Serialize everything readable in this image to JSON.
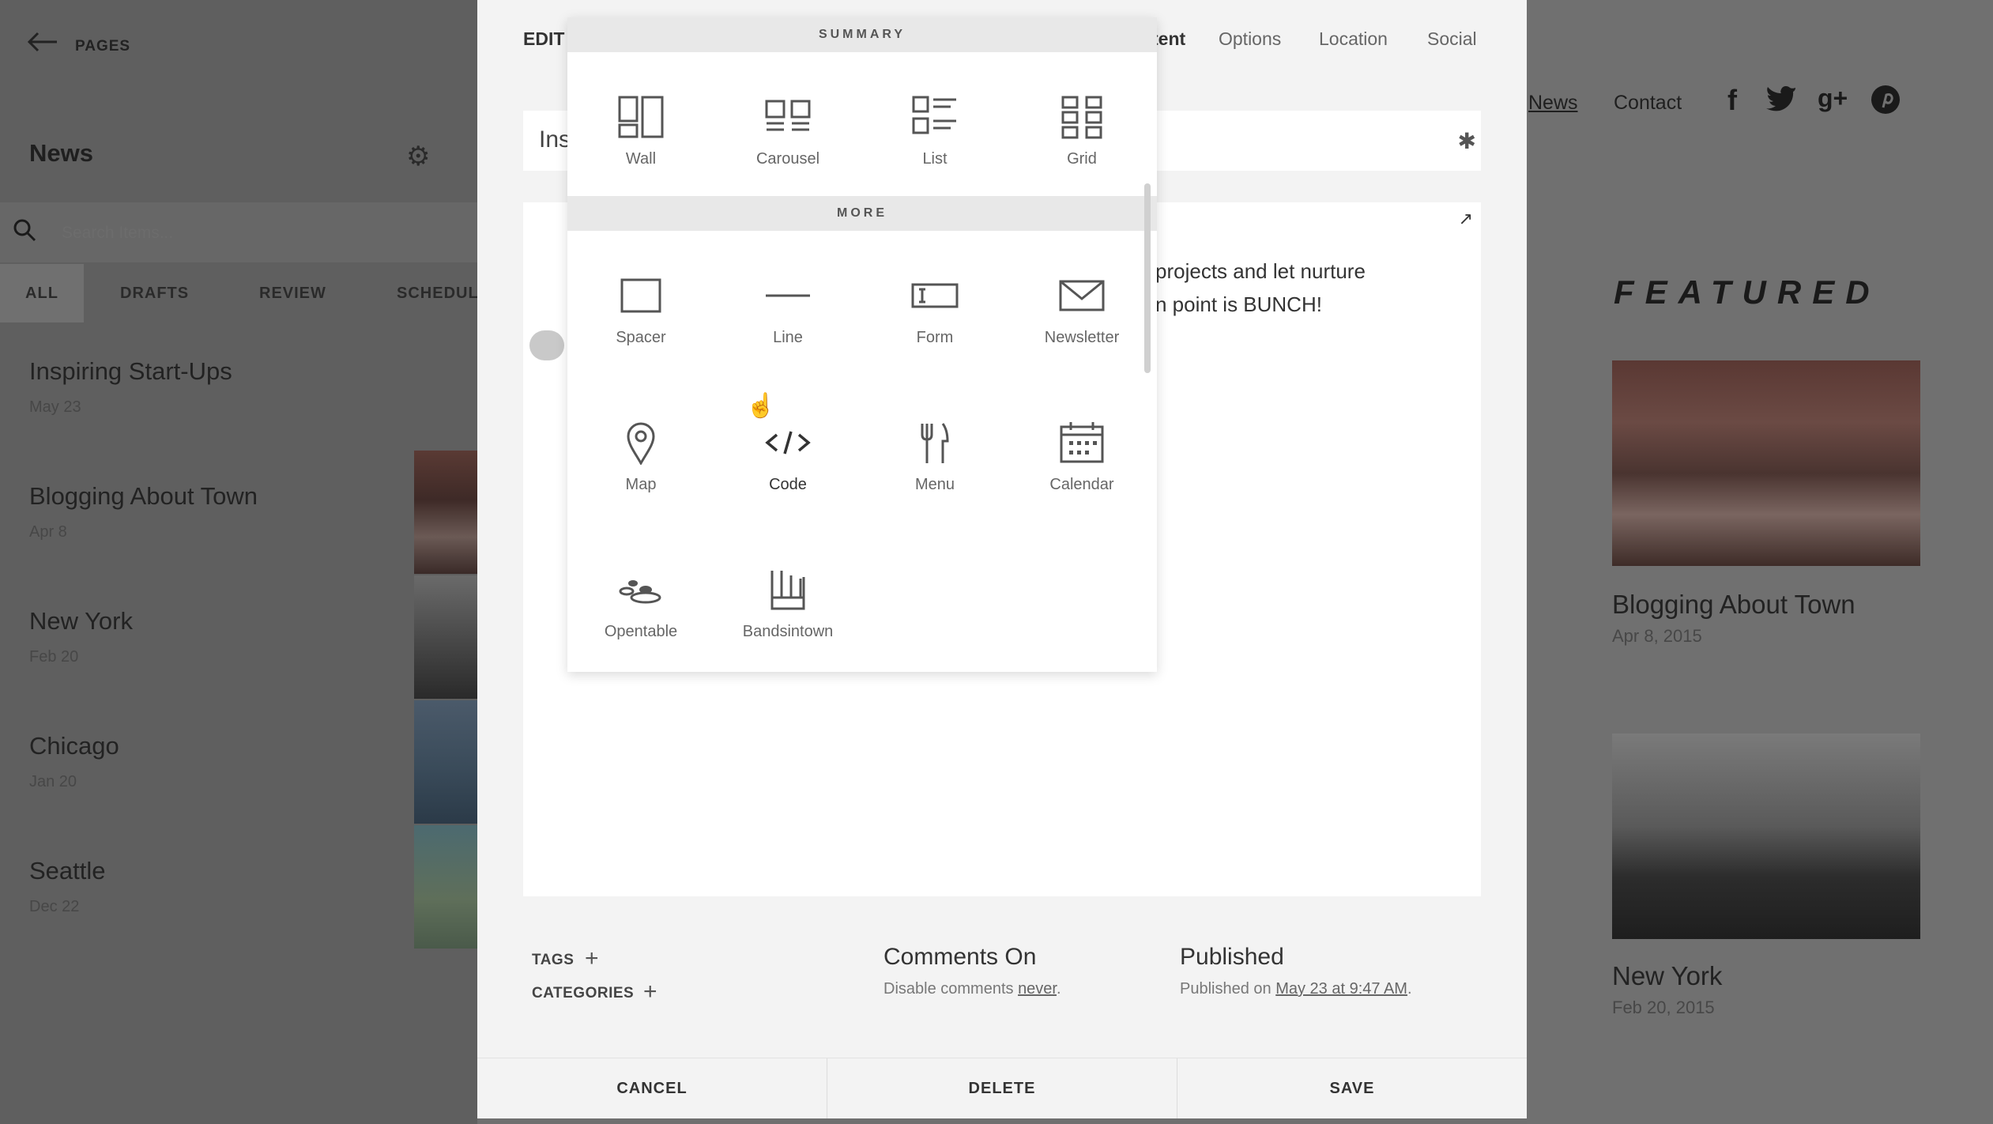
{
  "sidebar": {
    "back_label": "PAGES",
    "title": "News",
    "search_placeholder": "Search Items...",
    "tabs": [
      "ALL",
      "DRAFTS",
      "REVIEW",
      "SCHEDUL"
    ],
    "active_tab": "ALL",
    "items": [
      {
        "title": "Inspiring Start-Ups",
        "date": "May 23"
      },
      {
        "title": "Blogging About Town",
        "date": "Apr 8"
      },
      {
        "title": "New York",
        "date": "Feb 20"
      },
      {
        "title": "Chicago",
        "date": "Jan 20"
      },
      {
        "title": "Seattle",
        "date": "Dec 22"
      }
    ]
  },
  "preview": {
    "nav": [
      "News",
      "Contact"
    ],
    "social_icons": [
      "facebook-icon",
      "twitter-icon",
      "google-plus-icon",
      "pinterest-icon"
    ],
    "featured_heading": "FEATURED",
    "featured": [
      {
        "title": "Blogging About Town",
        "date": "Apr 8, 2015"
      },
      {
        "title": "New York",
        "date": "Feb 20, 2015"
      }
    ]
  },
  "editor": {
    "header_left": "EDIT",
    "tabs": [
      "tent",
      "Options",
      "Location",
      "Social"
    ],
    "title_partial": "Ins",
    "body_line1": "projects and let nurture",
    "body_line2": "n point is BUNCH!",
    "tags_label": "TAGS",
    "categories_label": "CATEGORIES",
    "comments_title": "Comments On",
    "comments_sub_prefix": "Disable comments ",
    "comments_sub_link": "never",
    "status_title": "Published",
    "status_sub_prefix": "Published on ",
    "status_sub_link": "May 23 at 9:47 AM",
    "footer": {
      "cancel": "CANCEL",
      "delete": "DELETE",
      "save": "SAVE"
    }
  },
  "picker": {
    "summary_label": "SUMMARY",
    "more_label": "MORE",
    "summary_blocks": [
      "Wall",
      "Carousel",
      "List",
      "Grid"
    ],
    "more_blocks": [
      "Spacer",
      "Line",
      "Form",
      "Newsletter",
      "Map",
      "Code",
      "Menu",
      "Calendar",
      "Opentable",
      "Bandsintown"
    ]
  },
  "colors": {
    "accent": "#333333",
    "modal_bg": "#f3f3f3",
    "overlay": "#6f6f6f"
  }
}
